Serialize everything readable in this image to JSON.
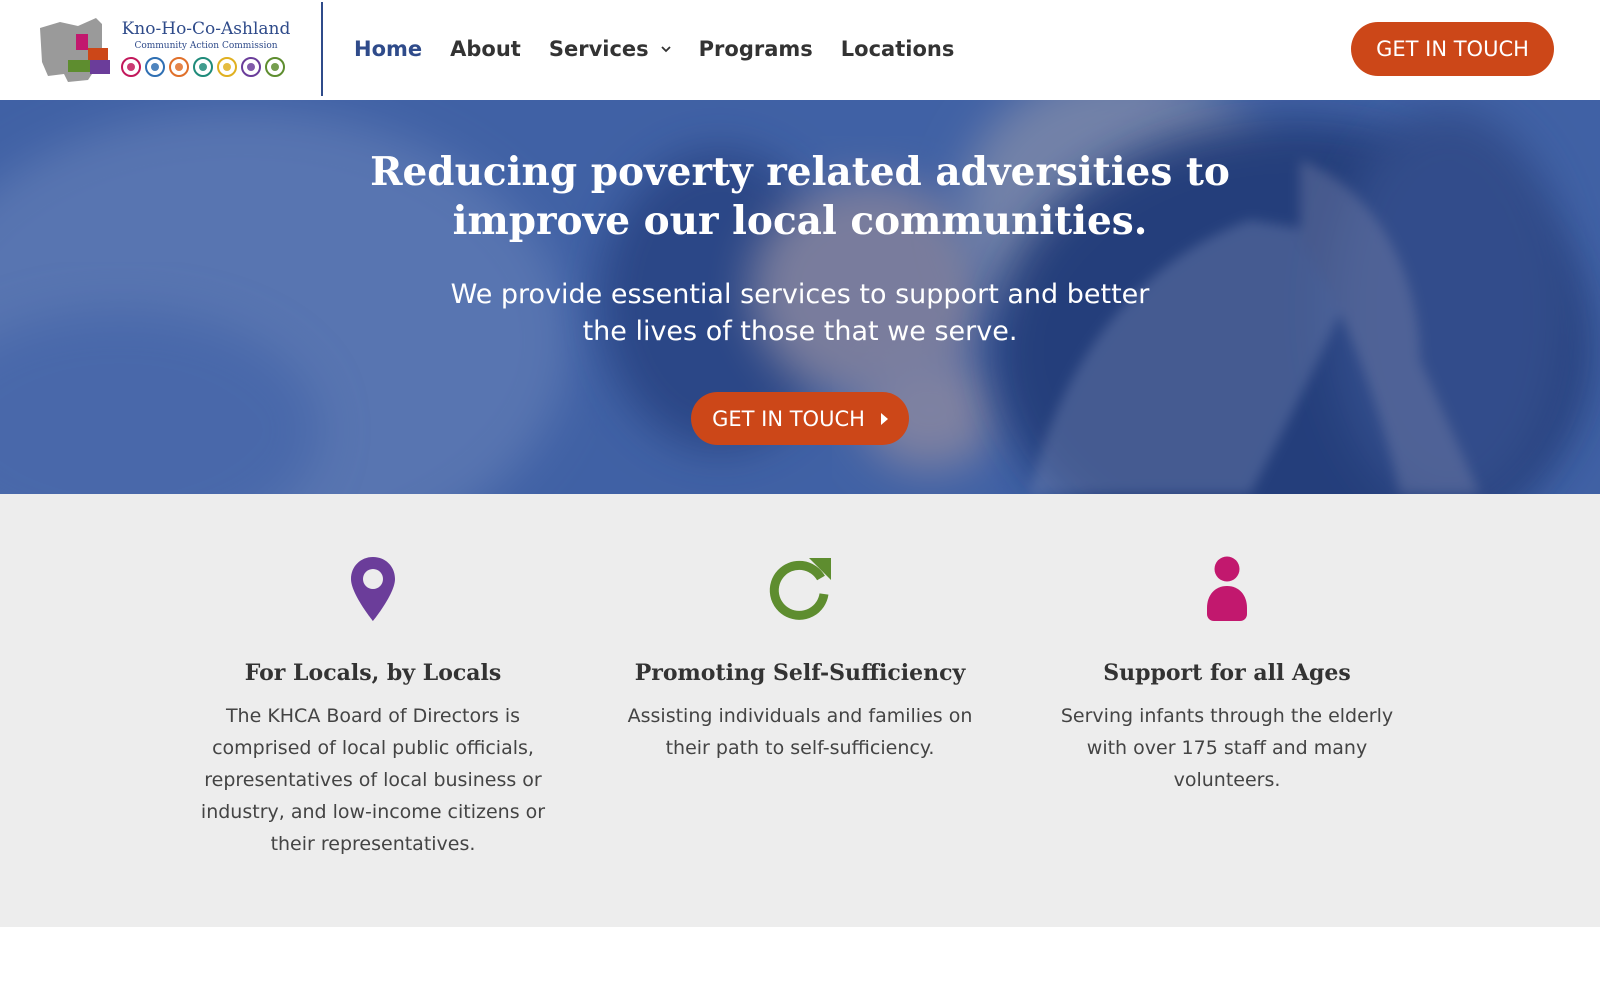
{
  "brand": {
    "name": "Kno-Ho-Co-Ashland",
    "subtitle": "Community Action Commission",
    "program_colors": [
      "#c2185b",
      "#2f6fb3",
      "#e0702a",
      "#1f8b7a",
      "#e0b020",
      "#6a3d9a",
      "#5e8d2f"
    ]
  },
  "nav": {
    "items": [
      {
        "label": "Home",
        "active": true
      },
      {
        "label": "About"
      },
      {
        "label": "Services",
        "has_dropdown": true
      },
      {
        "label": "Programs"
      },
      {
        "label": "Locations"
      }
    ],
    "cta_label": "GET IN TOUCH"
  },
  "hero": {
    "title": "Reducing poverty related adversities to improve our local communities.",
    "subtitle": "We provide essential services to support and better the lives of those that we serve.",
    "cta_label": "GET IN TOUCH"
  },
  "features": [
    {
      "icon": "map-pin-icon",
      "icon_color": "#6b3d9a",
      "title": "For Locals, by Locals",
      "text": "The KHCA Board of Directors is comprised of local public officials, representatives of local business or industry, and low-income citizens or their representatives."
    },
    {
      "icon": "refresh-icon",
      "icon_color": "#5e8d2f",
      "title": "Promoting Self-Sufficiency",
      "text": "Assisting individuals and families on their path to self-sufficiency."
    },
    {
      "icon": "person-icon",
      "icon_color": "#c2186e",
      "title": "Support for all Ages",
      "text": "Serving infants through the elderly with over 175 staff and many volunteers."
    }
  ],
  "colors": {
    "primary": "#2f4b8a",
    "accent": "#cc4718",
    "hero_overlay": "#2c4c96",
    "features_bg": "#ededed"
  }
}
